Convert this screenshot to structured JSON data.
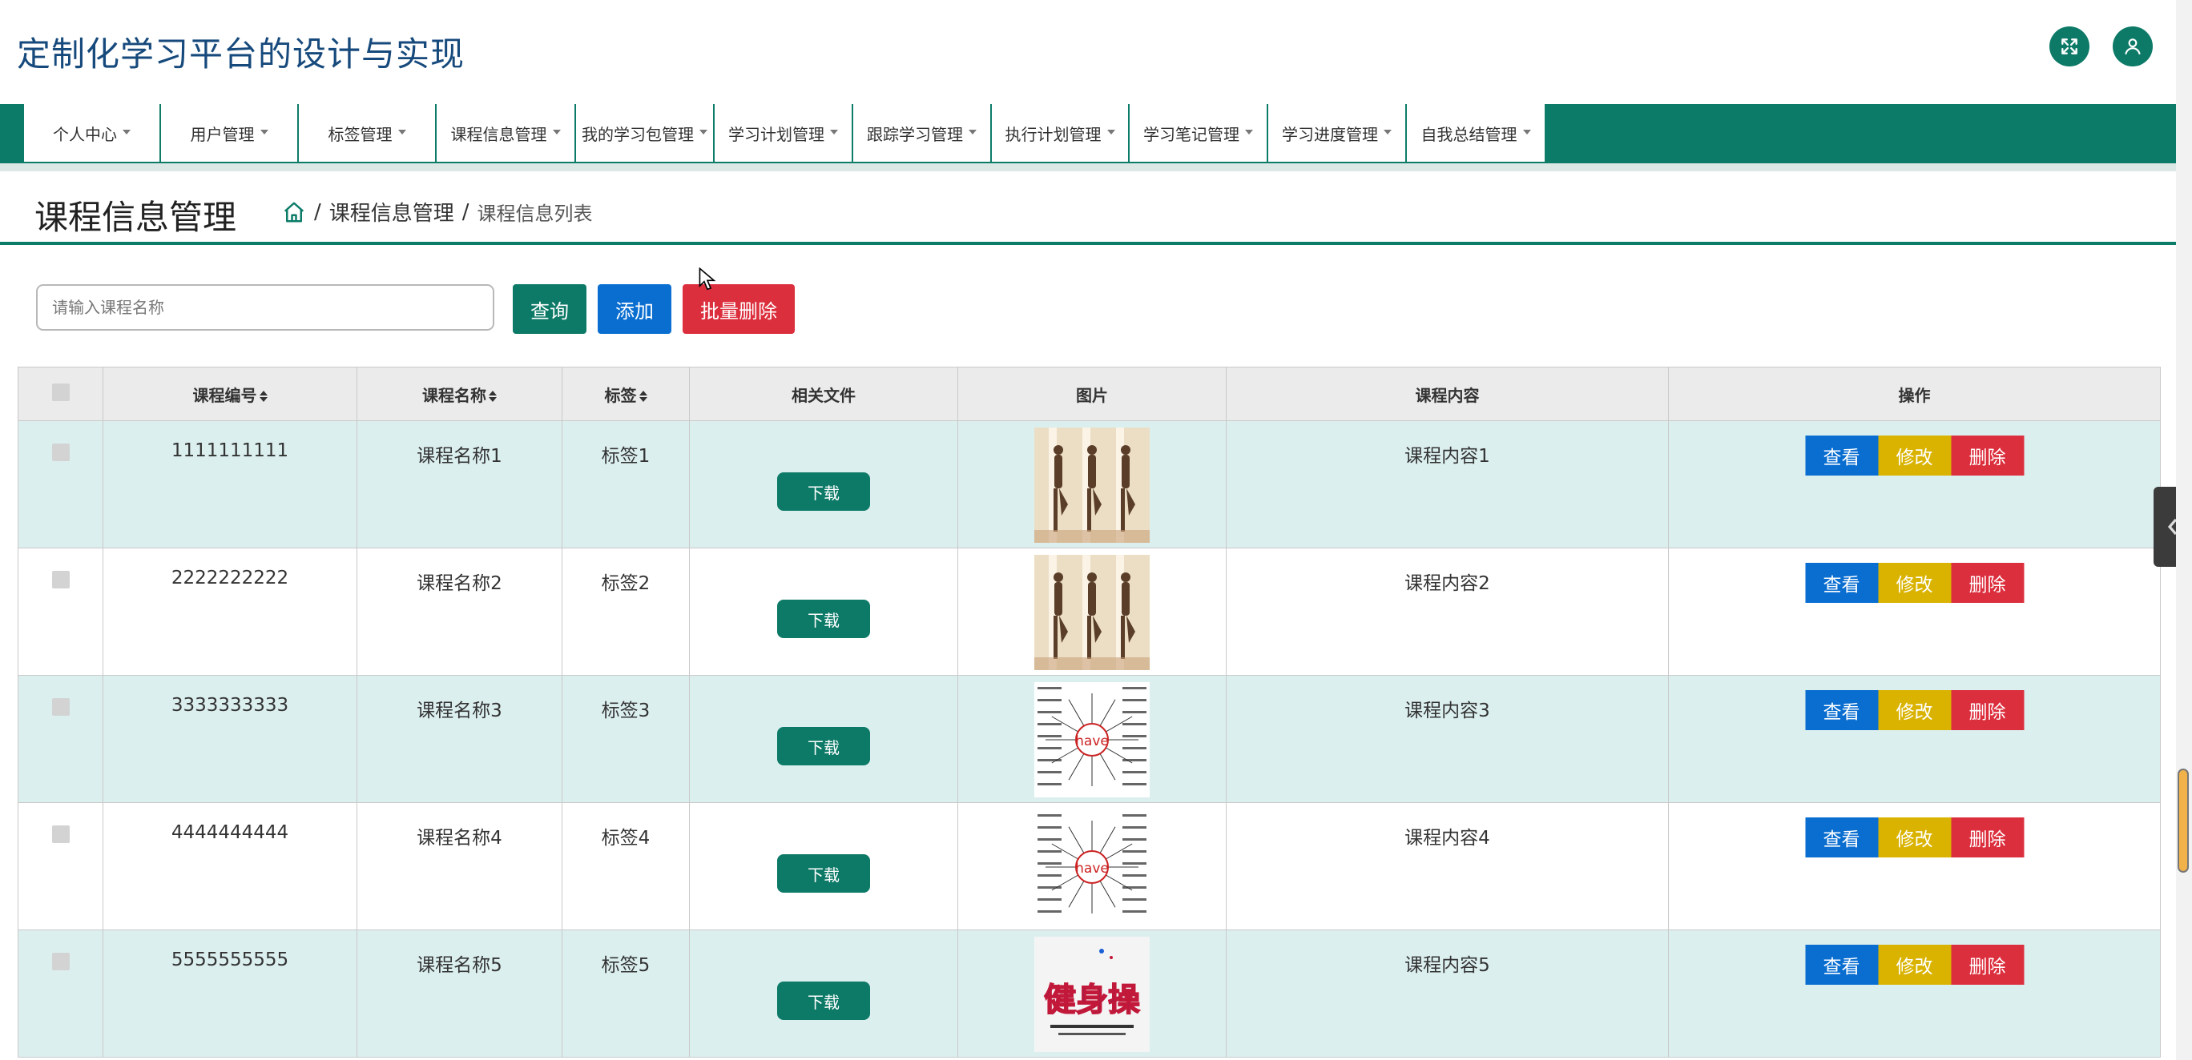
{
  "app": {
    "title": "定制化学习平台的设计与实现"
  },
  "header_icons": [
    "fullscreen-icon",
    "user-icon"
  ],
  "nav": {
    "items": [
      {
        "label": "个人中心"
      },
      {
        "label": "用户管理"
      },
      {
        "label": "标签管理"
      },
      {
        "label": "课程信息管理"
      },
      {
        "label": "我的学习包管理"
      },
      {
        "label": "学习计划管理"
      },
      {
        "label": "跟踪学习管理"
      },
      {
        "label": "执行计划管理"
      },
      {
        "label": "学习笔记管理"
      },
      {
        "label": "学习进度管理"
      },
      {
        "label": "自我总结管理"
      }
    ]
  },
  "page": {
    "title": "课程信息管理",
    "breadcrumb": {
      "sep": "/",
      "section": "课程信息管理",
      "current": "课程信息列表"
    }
  },
  "search": {
    "placeholder": "请输入课程名称",
    "value": ""
  },
  "actions": {
    "query": "查询",
    "add": "添加",
    "batch_delete": "批量删除"
  },
  "table": {
    "headers": {
      "code": "课程编号",
      "name": "课程名称",
      "tag": "标签",
      "file": "相关文件",
      "image": "图片",
      "content": "课程内容",
      "ops": "操作"
    },
    "download_label": "下载",
    "op_labels": {
      "view": "查看",
      "edit": "修改",
      "delete": "删除"
    },
    "rows": [
      {
        "code": "1111111111",
        "name": "课程名称1",
        "tag": "标签1",
        "content": "课程内容1",
        "image": "dance"
      },
      {
        "code": "2222222222",
        "name": "课程名称2",
        "tag": "标签2",
        "content": "课程内容2",
        "image": "dance"
      },
      {
        "code": "3333333333",
        "name": "课程名称3",
        "tag": "标签3",
        "content": "课程内容3",
        "image": "have"
      },
      {
        "code": "4444444444",
        "name": "课程名称4",
        "tag": "标签4",
        "content": "课程内容4",
        "image": "have"
      },
      {
        "code": "5555555555",
        "name": "课程名称5",
        "tag": "标签5",
        "content": "课程内容5",
        "image": "jiancao"
      }
    ]
  },
  "image_texts": {
    "have": "have",
    "jiancao": "健身操"
  },
  "colors": {
    "primary": "#0c7c69",
    "title": "#174a7c",
    "view": "#0a6ed1",
    "edit": "#d9b300",
    "delete": "#dc2f3e",
    "add": "#0a6ed1",
    "batch_delete": "#dc2f3e",
    "row_alt": "#dcefef"
  }
}
